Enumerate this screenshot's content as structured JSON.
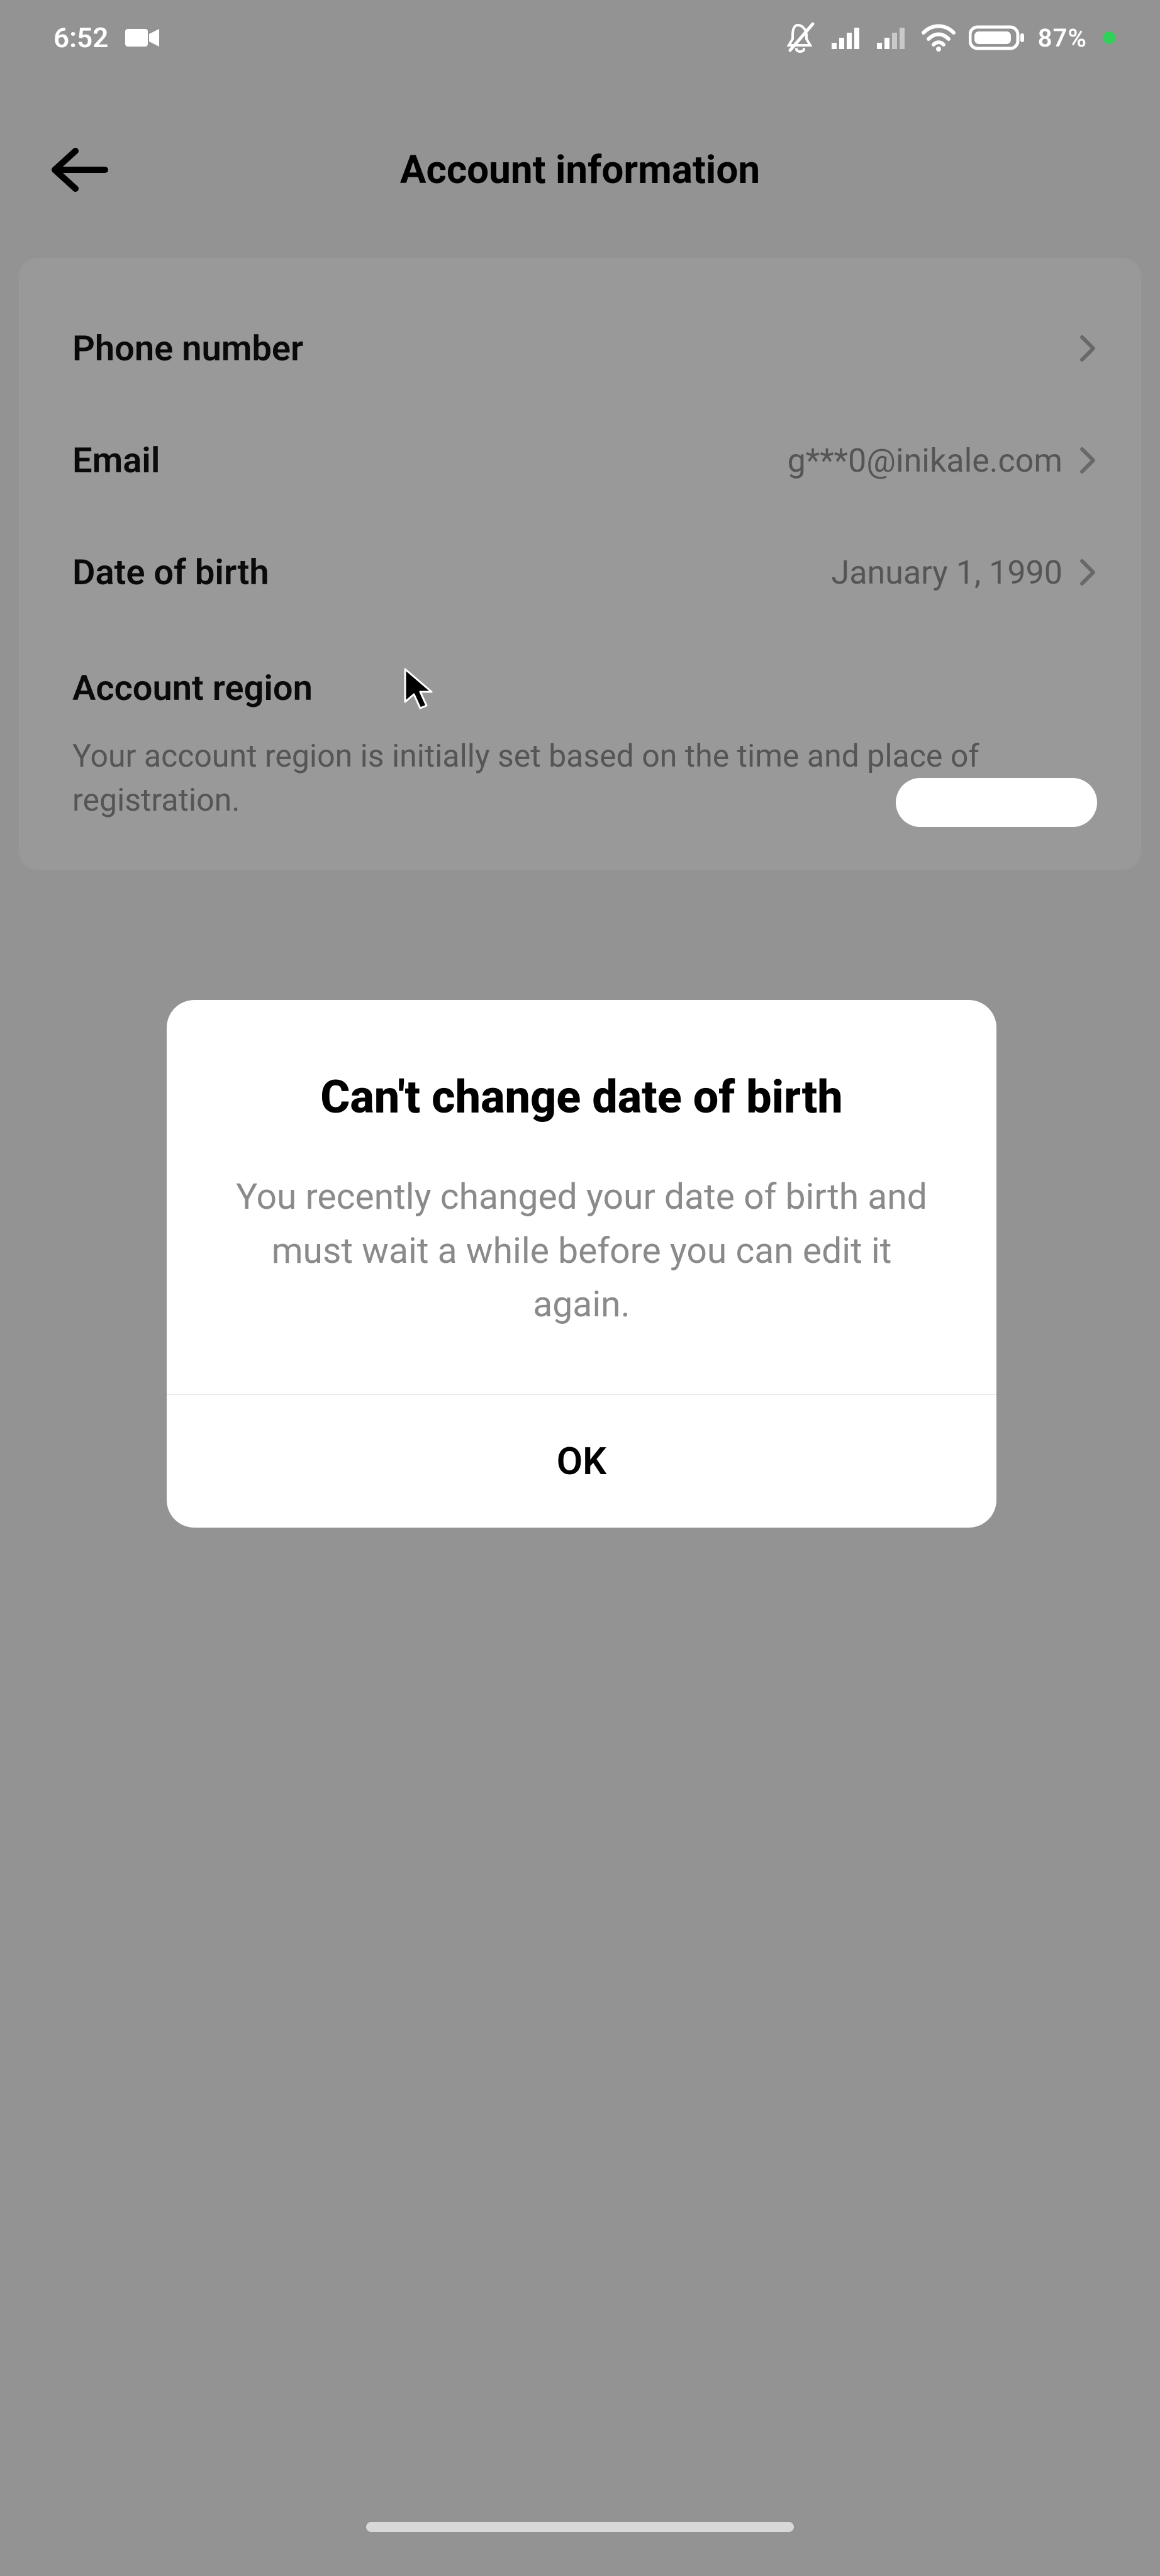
{
  "statusBar": {
    "time": "6:52",
    "batteryPct": "87%"
  },
  "header": {
    "title": "Account information"
  },
  "rows": {
    "phone": {
      "label": "Phone number",
      "value": ""
    },
    "email": {
      "label": "Email",
      "value": "g***0@inikale.com"
    },
    "dob": {
      "label": "Date of birth",
      "value": "January 1, 1990"
    },
    "region": {
      "label": "Account region",
      "desc": "Your account region is initially set based on the time and place of registration."
    }
  },
  "modal": {
    "title": "Can't change date of birth",
    "text": "You recently changed your date of birth and must wait a while before you can edit it again.",
    "ok": "OK"
  }
}
